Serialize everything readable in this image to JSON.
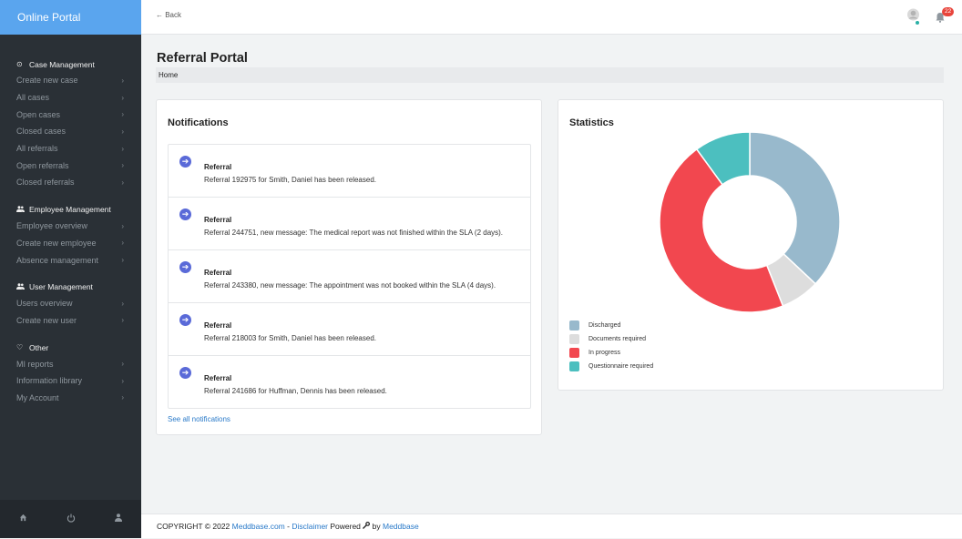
{
  "app": {
    "brand": "Online Portal"
  },
  "topbar": {
    "back_label": "← Back",
    "notification_count": "22"
  },
  "page": {
    "title": "Referral Portal",
    "breadcrumb": "Home"
  },
  "sidebar": {
    "groups": [
      {
        "heading": "Case Management",
        "icon": "circle-chevron-icon",
        "items": [
          "Create new case",
          "All cases",
          "Open cases",
          "Closed cases",
          "All referrals",
          "Open referrals",
          "Closed referrals"
        ]
      },
      {
        "heading": "Employee Management",
        "icon": "users-icon",
        "items": [
          "Employee overview",
          "Create new employee",
          "Absence management"
        ]
      },
      {
        "heading": "User Management",
        "icon": "users-icon",
        "items": [
          "Users overview",
          "Create new user"
        ]
      },
      {
        "heading": "Other",
        "icon": "heart-icon",
        "items": [
          "MI reports",
          "Information library",
          "My Account"
        ]
      }
    ],
    "chevron": "›",
    "footer_icons": [
      "home-icon",
      "power-icon",
      "user-icon"
    ]
  },
  "notifications": {
    "title": "Notifications",
    "items": [
      {
        "title": "Referral",
        "text": "Referral 192975 for Smith, Daniel has been released."
      },
      {
        "title": "Referral",
        "text": "Referral 244751, new message: The medical report was not finished within the SLA (2 days)."
      },
      {
        "title": "Referral",
        "text": "Referral 243380, new message: The appointment was not booked within the SLA (4 days)."
      },
      {
        "title": "Referral",
        "text": "Referral 218003 for Smith, Daniel has been released."
      },
      {
        "title": "Referral",
        "text": "Referral 241686 for Huffman, Dennis has been released."
      }
    ],
    "see_all": "See all notifications"
  },
  "statistics": {
    "title": "Statistics"
  },
  "chart_data": {
    "type": "pie",
    "categories": [
      "Discharged",
      "Documents required",
      "In progress",
      "Questionnaire required"
    ],
    "values": [
      37,
      7,
      46,
      10
    ],
    "colors": [
      "#98b9cc",
      "#dddddd",
      "#f2474f",
      "#4cbfbf"
    ],
    "legend": "bottom-left"
  },
  "footer": {
    "prefix": "COPYRIGHT © 2022 ",
    "site": "Meddbase.com",
    "sep": " - ",
    "disclaimer": "Disclaimer",
    "powered": " Powered ",
    "by": " by ",
    "vendor": "Meddbase"
  }
}
